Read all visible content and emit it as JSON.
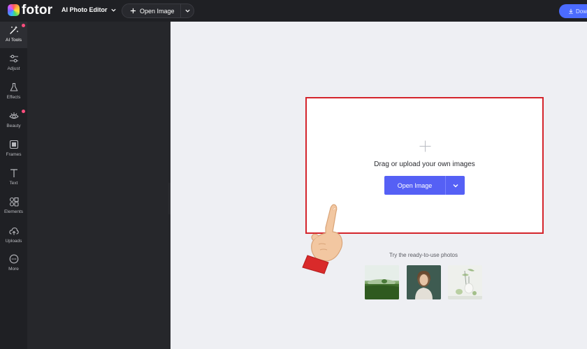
{
  "app": {
    "logo_text": "fotor",
    "mode_label": "AI Photo Editor",
    "open_image_label": "Open Image",
    "download_label": "Dow"
  },
  "rail": [
    {
      "label": "AI Tools",
      "icon": "magic-wand-icon",
      "active": true,
      "dot": true
    },
    {
      "label": "Adjust",
      "icon": "sliders-icon"
    },
    {
      "label": "Effects",
      "icon": "flask-icon"
    },
    {
      "label": "Beauty",
      "icon": "eye-icon",
      "dot": true
    },
    {
      "label": "Frames",
      "icon": "frame-icon"
    },
    {
      "label": "Text",
      "icon": "text-icon"
    },
    {
      "label": "Elements",
      "icon": "shapes-icon"
    },
    {
      "label": "Uploads",
      "icon": "cloud-upload-icon"
    },
    {
      "label": "More",
      "icon": "more-icon"
    }
  ],
  "dropzone": {
    "prompt": "Drag or upload your own images",
    "button_label": "Open Image"
  },
  "samples": {
    "heading": "Try the ready-to-use photos",
    "items": [
      "landscape",
      "portrait",
      "still-life"
    ]
  },
  "colors": {
    "accent": "#5560f5",
    "highlight": "#d4242b",
    "rail_bg": "#1f2024",
    "panel_bg": "#26272b",
    "canvas_bg": "#eeeff3"
  }
}
